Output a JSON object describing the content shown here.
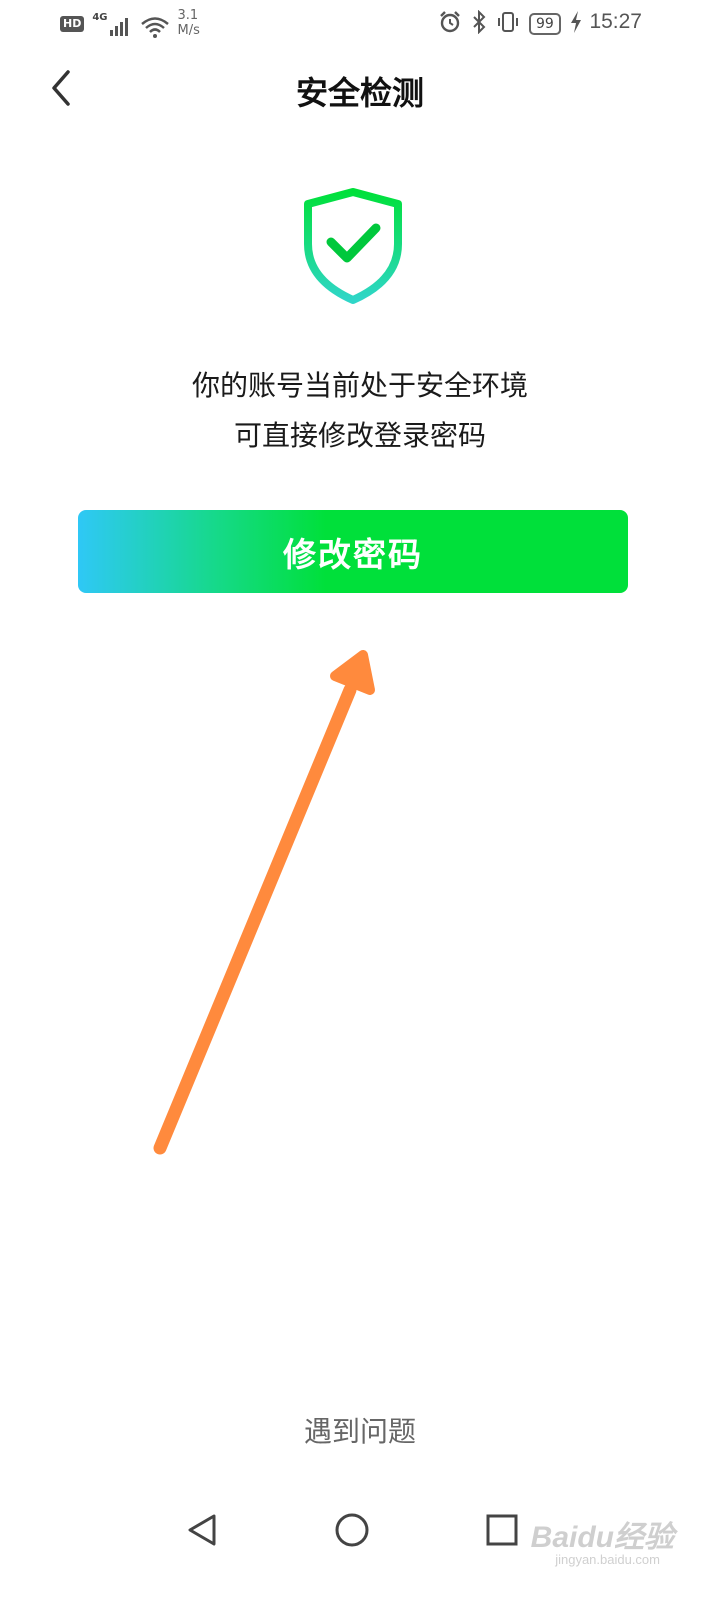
{
  "status_bar": {
    "hd_label": "HD",
    "network_label": "4G",
    "speed_value": "3.1",
    "speed_unit": "M/s",
    "battery_level": "99",
    "time": "15:27",
    "icons": [
      "signal-icon",
      "wifi-icon",
      "alarm-icon",
      "bluetooth-icon",
      "vibrate-icon",
      "battery-icon",
      "charging-icon"
    ]
  },
  "header": {
    "title": "安全检测",
    "back_icon": "chevron-left-icon"
  },
  "status": {
    "icon": "shield-check-icon",
    "line1": "你的账号当前处于安全环境",
    "line2": "可直接修改登录密码"
  },
  "primary_button": {
    "label": "修改密码"
  },
  "help": {
    "label": "遇到问题"
  },
  "nav_bar": {
    "buttons": [
      "nav-back-icon",
      "nav-home-icon",
      "nav-recent-icon"
    ]
  },
  "watermark": {
    "text": "Baidu经验",
    "sub": "jingyan.baidu.com"
  },
  "colors": {
    "accent_green": "#00e03a",
    "gradient_start": "#2fc8f6",
    "arrow": "#ff8a3d"
  }
}
